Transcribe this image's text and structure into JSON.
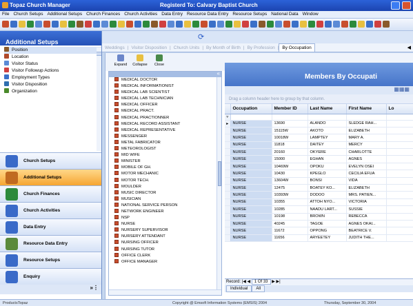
{
  "window": {
    "app_title": "Topaz Church Manager",
    "registration": "Registerd To: Calvary Baptist Church"
  },
  "menu": [
    "File",
    "Church Setups",
    "Additional Setups",
    "Church Finances",
    "Church Activities",
    "Data Entry",
    "Resource Data Entry",
    "Resource Setups",
    "National Data",
    "Window"
  ],
  "tabs": [
    "Weddings",
    "Visitor Disposition",
    "Church Units",
    "By Month of Birth",
    "By Profession",
    "By Occupation"
  ],
  "sidebar": {
    "title": "Additional Setups",
    "items": [
      {
        "label": "Position",
        "icon": "position-icon",
        "color": "#8a5a2b"
      },
      {
        "label": "Location",
        "icon": "location-icon",
        "color": "#b04a2a"
      },
      {
        "label": "Visitor Status",
        "icon": "visitor-status-icon",
        "color": "#5b8ad6"
      },
      {
        "label": "Visitor Followup Actions",
        "icon": "followup-icon",
        "color": "#d04040"
      },
      {
        "label": "Employment Types",
        "icon": "employment-icon",
        "color": "#3b70c8"
      },
      {
        "label": "Visitor Disposition",
        "icon": "disposition-icon",
        "color": "#2f6fb0"
      },
      {
        "label": "Organization",
        "icon": "organization-icon",
        "color": "#4a8a2a"
      }
    ],
    "nav": [
      {
        "label": "Church Setups",
        "color": "#3a6ac8",
        "active": false
      },
      {
        "label": "Additional Setups",
        "color": "#c06a20",
        "active": true
      },
      {
        "label": "Church Finances",
        "color": "#2c8a3c",
        "active": false
      },
      {
        "label": "Church Activities",
        "color": "#3a6ac8",
        "active": false
      },
      {
        "label": "Data Entry",
        "color": "#3a6ac8",
        "active": false
      },
      {
        "label": "Resource Data Entry",
        "color": "#5a8a3c",
        "active": false
      },
      {
        "label": "Resource Setups",
        "color": "#3a6ac8",
        "active": false
      },
      {
        "label": "Enquiry",
        "color": "#3a6ac8",
        "active": false
      }
    ]
  },
  "child_toolbar": {
    "expand": "Expand",
    "collapse": "Collapse",
    "close": "Close"
  },
  "occupations": [
    "MEDICAL DOCTOR",
    "MEDICAL INFORMATIONIST",
    "MEDICAL LAB SCIENTIST",
    "MEDICAL LAB TECHNICIAN",
    "MEDICAL OFFICER",
    "MEDICAL PRACT.",
    "MEDICAL PRACTIONNER",
    "MEDICAL RECORD ASSISTANT",
    "MEDICAL REPRESENTATIVE",
    "MESSENGER",
    "METAL FABRICATOR",
    "METEOROLOGIST",
    "MID WIFE",
    "MINISTER",
    "MOBILE OF GH.",
    "MOTOR MECHANIC",
    "MOTOR TECH.",
    "MOULDER",
    "MUSIC DIRECTOR",
    "MUSICIAN",
    "NATIONAL SERVICE PERSON",
    "NETWORK ENGINEER",
    "NSP",
    "NURSE",
    "NURSERY SUPERVISOR",
    "NURSERY ATTENDANT",
    "NURSING OFFICER",
    "NURSING TUTOR",
    "OFFICE CLERK",
    "OFFICE MANAGER"
  ],
  "grid": {
    "title": "Members By Occupati",
    "group_hint": "Drag a column header here to group by that column.",
    "columns": [
      "Occupation",
      "Member ID",
      "Last Name",
      "First Name",
      "Lo"
    ],
    "rows": [
      [
        "NURSE",
        "13690",
        "ALANDO",
        "SLEDGE RAH..."
      ],
      [
        "NURSE",
        "15115W",
        "AKOTO",
        "ELIZABETH"
      ],
      [
        "NURSE",
        "10018W",
        "LAMPTEY",
        "MARY A."
      ],
      [
        "NURSE",
        "11818",
        "DAITEY",
        "MERCY"
      ],
      [
        "NURSE",
        "20160",
        "OKYERE",
        "CHARLOTTE"
      ],
      [
        "NURSE",
        "15000",
        "EGHAN",
        "AGNES"
      ],
      [
        "NURSE",
        "10469W",
        "OPOKU",
        "EVELYN OSEI"
      ],
      [
        "NURSE",
        "10430",
        "KPEGLO",
        "CECILIA EFUA"
      ],
      [
        "NURSE",
        "13604W",
        "BONSI",
        "VIDA"
      ],
      [
        "NURSE",
        "12475",
        "BOATEY KO...",
        "ELIZABETH"
      ],
      [
        "NURSE",
        "10393W",
        "DODOO",
        "MRS. PATIEN..."
      ],
      [
        "NURSE",
        "10355",
        "ATTOH NYO...",
        "VICTORIA"
      ],
      [
        "NURSE",
        "10285",
        "NAADU LART...",
        "SUSSIE"
      ],
      [
        "NURSE",
        "10198",
        "BROWN",
        "REBECCA"
      ],
      [
        "NURSE",
        "40245",
        "TAGOE",
        "AGNES OKAI..."
      ],
      [
        "NURSE",
        "11672",
        "OPPONG",
        "BEATRICE V."
      ],
      [
        "NURSE",
        "11656",
        "ARYEETEY",
        "JUDITH THE..."
      ]
    ],
    "record_label": "Record:",
    "record_value": "1 Of 33",
    "view_tabs": [
      "Individual",
      "All"
    ]
  },
  "status": {
    "left": "ProductsTopaz",
    "center": "Copyright @ Emsoft Information Systems (EMSIS) 2004",
    "right": "Thursday, September 30, 2004"
  }
}
